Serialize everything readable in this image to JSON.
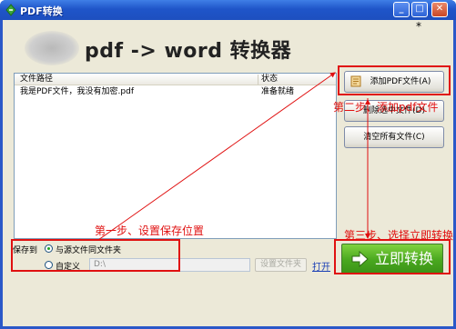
{
  "window": {
    "title": "PDF转换",
    "controls": {
      "minimize": "_",
      "maximize": "□",
      "close": "✕"
    }
  },
  "header": {
    "app_title": "pdf -> word 转换器",
    "corner_mark": "*"
  },
  "file_list": {
    "columns": [
      "文件路径",
      "状态"
    ],
    "rows": [
      {
        "path": "我是PDF文件，我没有加密.pdf",
        "status": "准备就绪"
      }
    ]
  },
  "side_buttons": {
    "add": "添加PDF文件(A)",
    "remove": "删除选中文件(D)",
    "clear": "清空所有文件(C)"
  },
  "save": {
    "label": "保存到",
    "option_same": "与源文件同文件夹",
    "option_custom": "自定义",
    "path_value": "D:\\",
    "browse_label": "设置文件夹",
    "open_link": "打开"
  },
  "convert": {
    "label": "立即转换"
  },
  "annotations": {
    "step1": "第一步、设置保存位置",
    "step2": "第二步、添加pdf文件",
    "step3": "第三步、选择立即转换"
  },
  "colors": {
    "annotation": "#e01010",
    "title_bar": "#1f55c9",
    "convert": "#4aa81f"
  },
  "icons": {
    "app": "app-icon",
    "add": "add-file-icon",
    "convert": "convert-arrow-icon"
  }
}
